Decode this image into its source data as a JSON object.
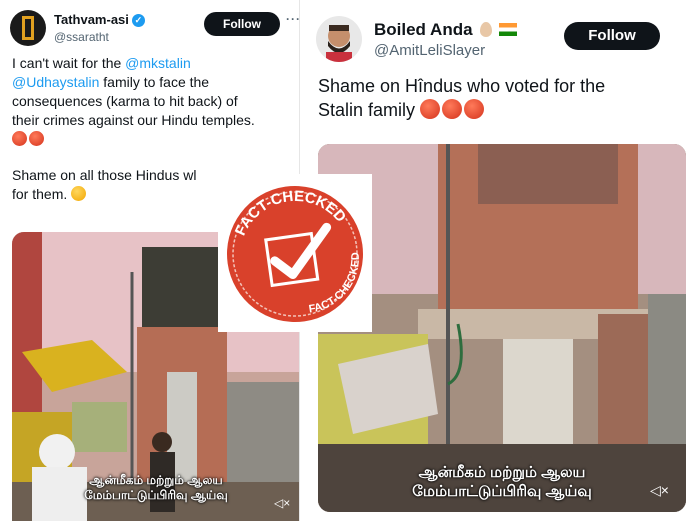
{
  "left_tweet": {
    "name": "Tathvam-asi",
    "handle": "@ssaratht",
    "follow_label": "Follow",
    "more": "···",
    "text": {
      "line1": "I can't wait for the ",
      "mention1": "@mkstalin",
      "mention2": "@Udhaystalin",
      "line2": " family to face the",
      "line3": "consequences (karma to hit back) of",
      "line4": "their crimes against our Hindu temples.",
      "line5": "Shame on all those Hindus wl",
      "line6": "for them. "
    },
    "subtitle_line1": "ஆன்மீகம் மற்றும் ஆலய",
    "subtitle_line2": "மேம்பாட்டுப்பிரிவு ஆய்வு"
  },
  "right_tweet": {
    "name": "Boiled Anda",
    "handle": "@AmitLeliSlayer",
    "follow_label": "Follow",
    "text_line1": "Shame on Hîndus who voted for the",
    "text_line2": "Stalin family ",
    "subtitle_line1": "ஆன்மீகம் மற்றும் ஆலய",
    "subtitle_line2": "மேம்பாட்டுப்பிரிவு ஆய்வு"
  },
  "stamp": {
    "top_text": "FACT-CHECKED",
    "side_text": "FACT-CHECKED",
    "color": "#d9412b"
  }
}
